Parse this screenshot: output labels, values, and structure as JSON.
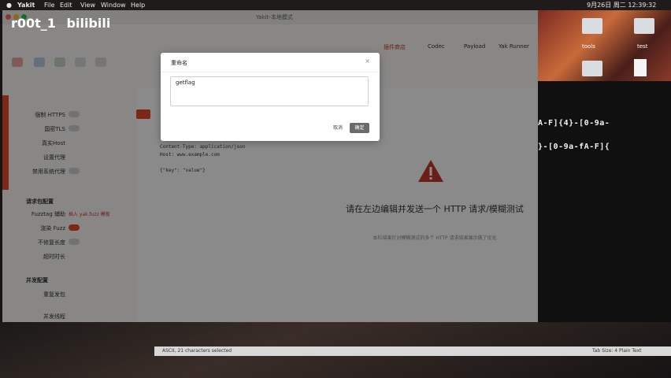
{
  "menubar": {
    "app_name": "Yakit",
    "items": [
      "File",
      "Edit",
      "View",
      "Window",
      "Help"
    ],
    "date_time": "9月26日 周二 12:39:32"
  },
  "watermark": {
    "user": "r00t_1",
    "brand": "bilibili"
  },
  "app": {
    "window_title": "Yakit-本地模式",
    "top_tools": [
      "插件商店",
      "Codec",
      "Payload",
      "Yak Runner"
    ],
    "left_settings": {
      "rows": [
        {
          "label": "强制 HTTPS",
          "on": false
        },
        {
          "label": "国密TLS",
          "on": false
        },
        {
          "label": "真实Host",
          "on": false
        },
        {
          "label": "设置代理",
          "on": false
        },
        {
          "label": "禁用系统代理",
          "on": false
        }
      ],
      "section_request": "请求包配置",
      "fuzz_label": "Fuzztag 辅助",
      "fuzz_link": "插入 yak.fuzz 模板",
      "render_fuzz": "渲染 Fuzz",
      "render_on": true,
      "no_fix_len": "不修复长度",
      "timeout": "超时时长",
      "section_concurrency": "并发配置",
      "repeat": "重复发包",
      "threads": "并发线程"
    },
    "request_code": [
      "Content-Type: application/json",
      "Host: www.example.com",
      "",
      "{\"key\": \"value\"}"
    ],
    "empty_state": {
      "title": "请在左边编辑并发送一个 HTTP 请求/模糊测试",
      "subtitle": "本栏结果针对模糊测试的多个 HTTP 请求结果展示做了优化"
    }
  },
  "modal": {
    "title": "重命名",
    "close_icon": "close-icon",
    "input_value": "getflag",
    "cancel_label": "取消",
    "confirm_label": "确定"
  },
  "desktop": {
    "folders": [
      "tools",
      "test"
    ]
  },
  "terminal": {
    "lines": [
      "A-F]{4}-[0-9a-",
      "}-[0-9a-fA-F]{"
    ]
  },
  "statusbar": {
    "left": "ASCII, 21 characters selected",
    "right": "Tab Size: 4    Plain Text"
  }
}
